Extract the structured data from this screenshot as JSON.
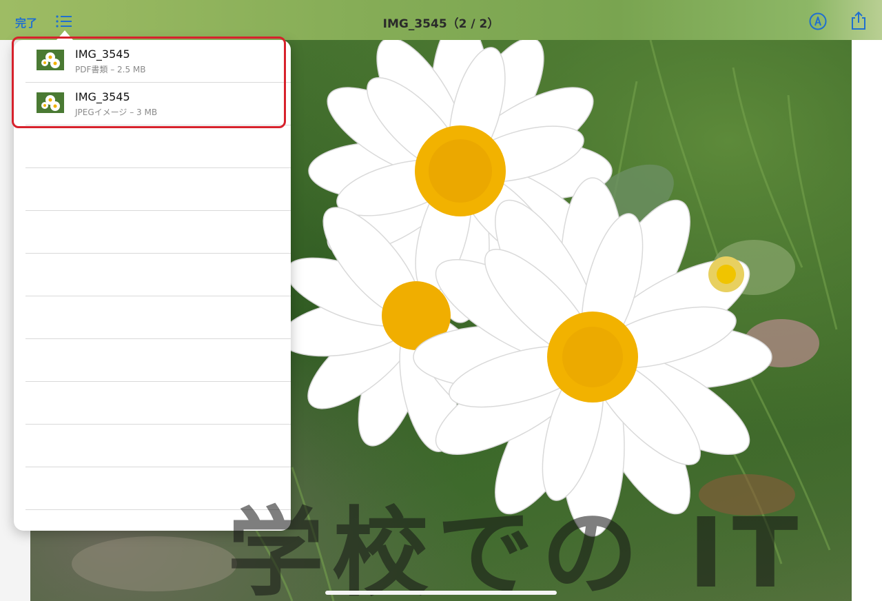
{
  "topbar": {
    "done_label": "完了",
    "title": "IMG_3545（2 / 2）"
  },
  "file_list": {
    "items": [
      {
        "name": "IMG_3545",
        "meta": "PDF書類 – 2.5 MB"
      },
      {
        "name": "IMG_3545",
        "meta": "JPEGイメージ – 3 MB"
      }
    ],
    "empty_row_count": 9
  },
  "watermark": "学校での IT",
  "colors": {
    "accent_blue": "#1f6fd0",
    "highlight_red": "#d7212c",
    "flower_center": "#f2b200",
    "petal_white": "#ffffff"
  },
  "icons": {
    "list": "list-icon",
    "markup": "markup-pen-icon",
    "share": "share-icon"
  }
}
